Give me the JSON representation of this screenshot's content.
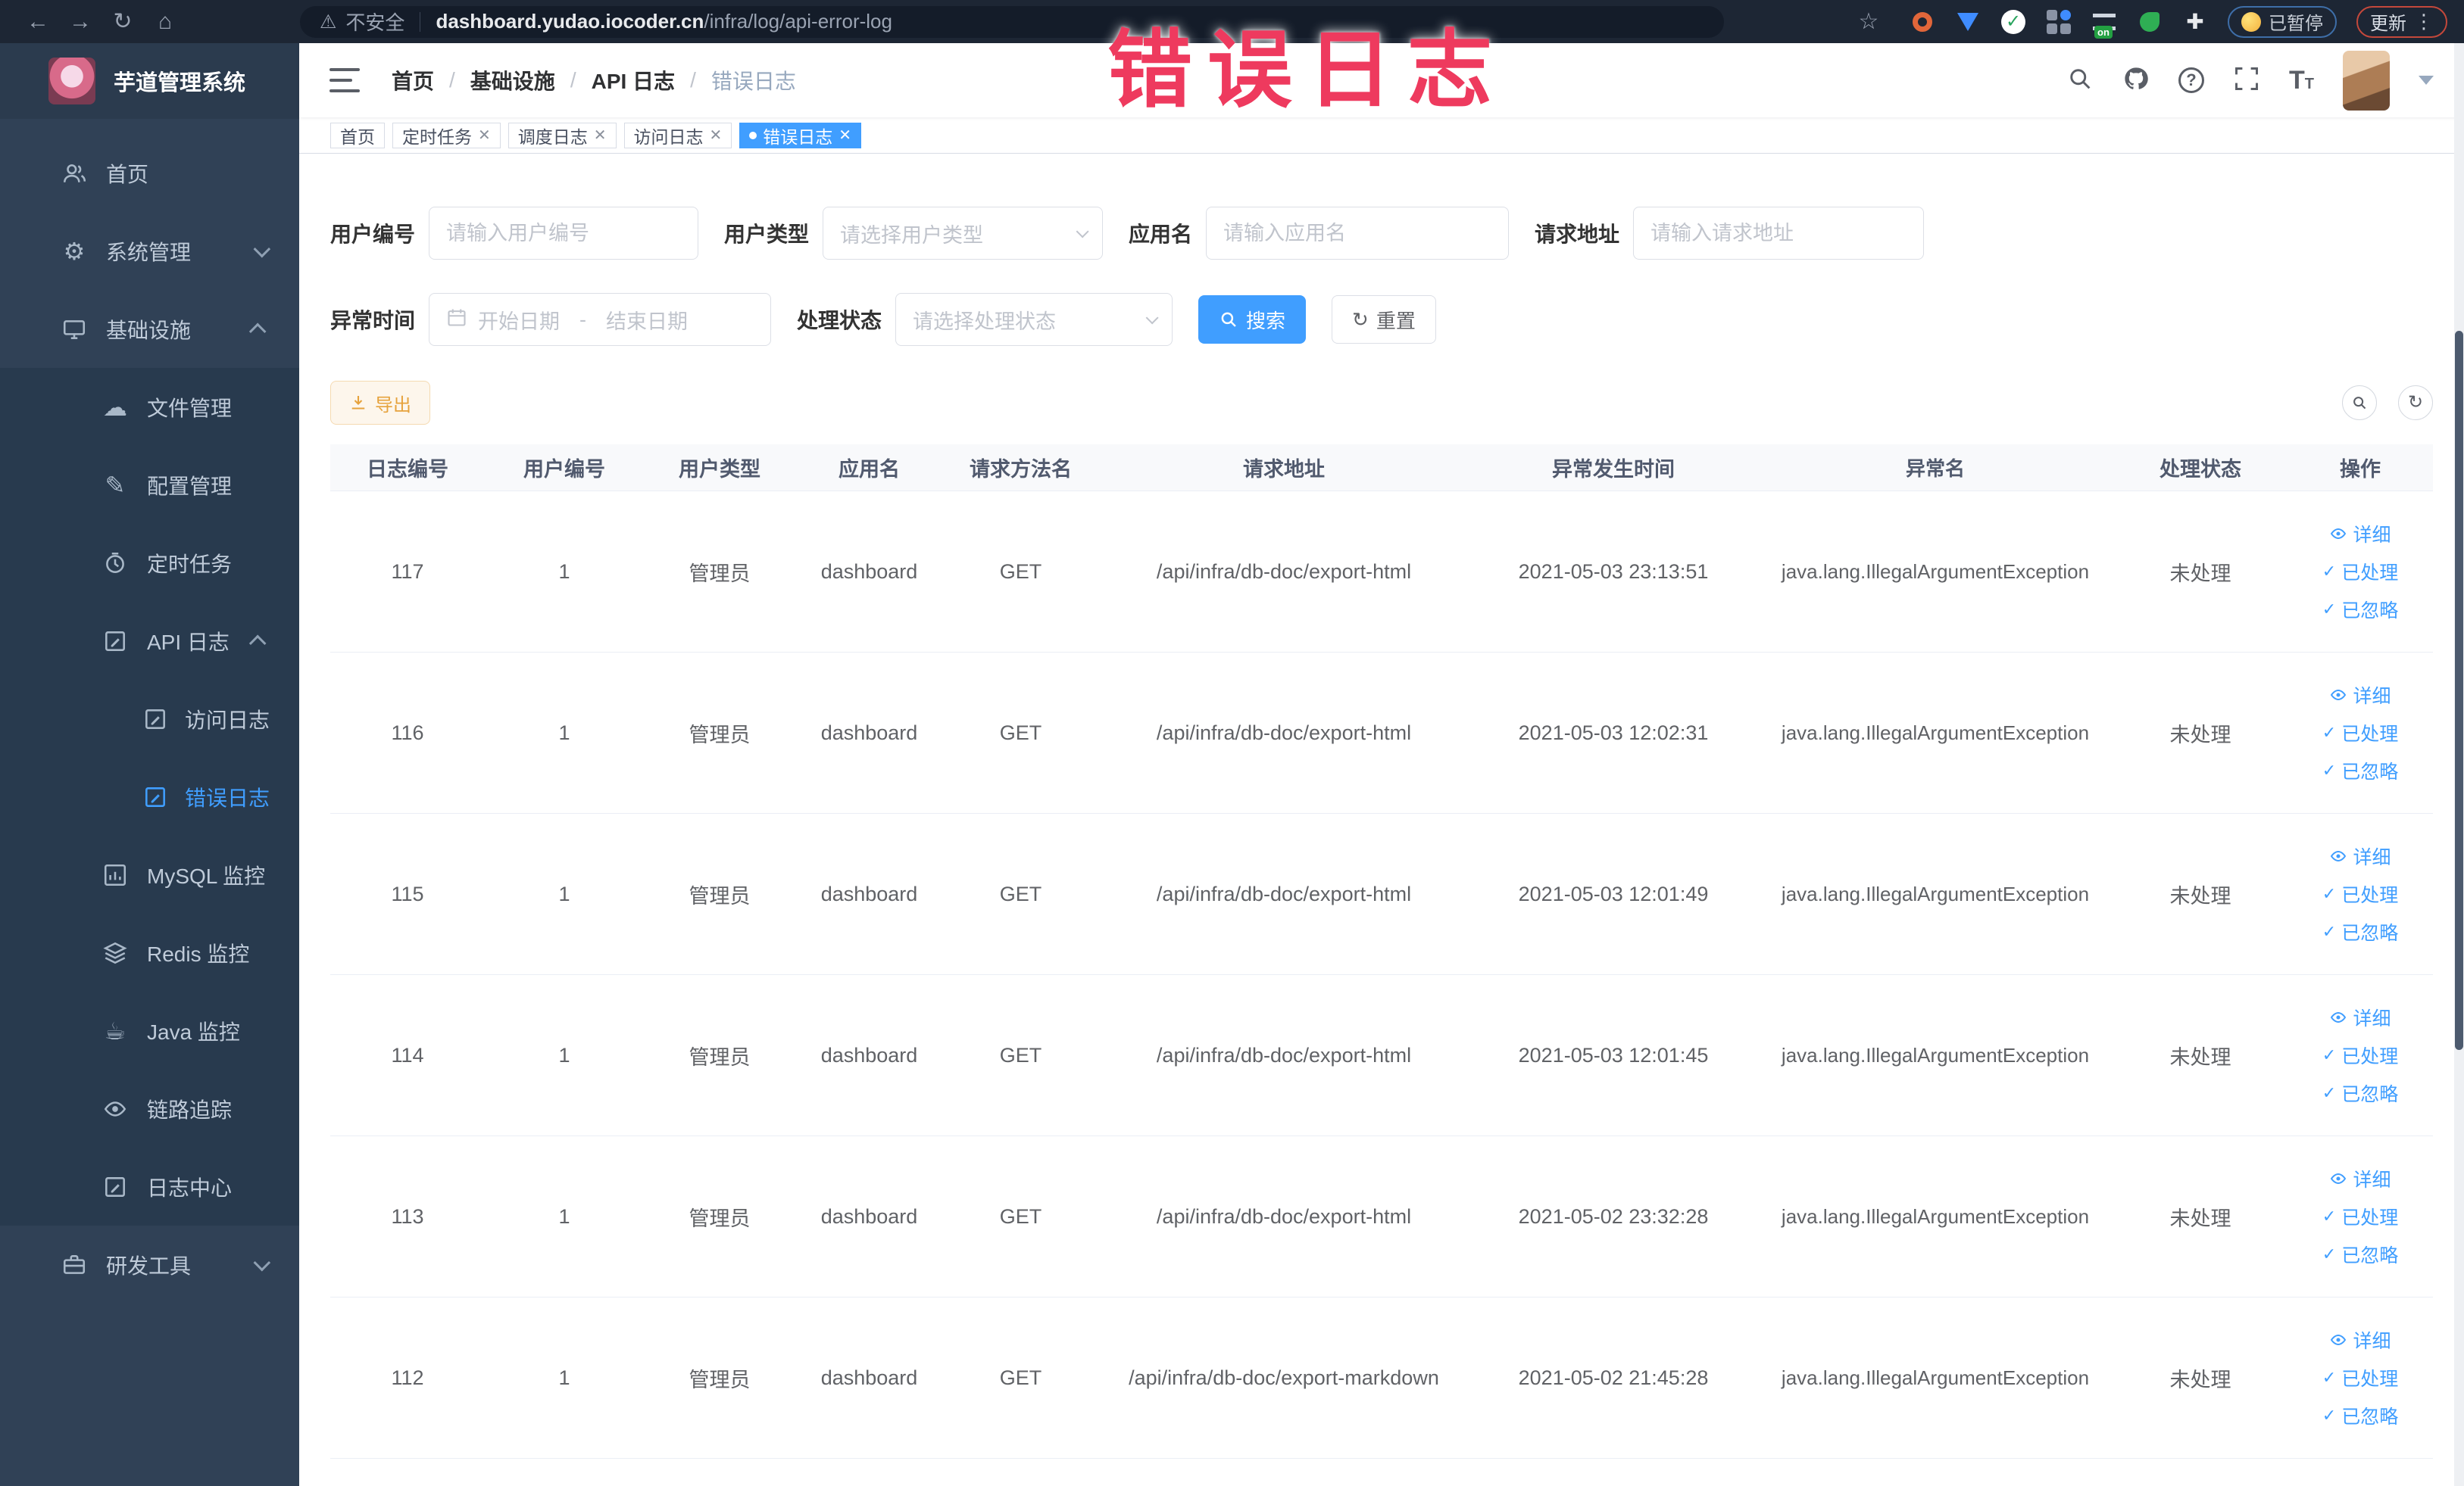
{
  "browser": {
    "security_label": "不安全",
    "url_domain": "dashboard.yudao.iocoder.cn",
    "url_path": "/infra/log/api-error-log",
    "paused_label": "已暂停",
    "update_label": "更新"
  },
  "annotation": {
    "text": "错误日志",
    "color": "#EE3A5E"
  },
  "sidebar": {
    "title": "芋道管理系统",
    "items": [
      {
        "label": "首页"
      },
      {
        "label": "系统管理"
      },
      {
        "label": "基础设施"
      },
      {
        "label": "文件管理"
      },
      {
        "label": "配置管理"
      },
      {
        "label": "定时任务"
      },
      {
        "label": "API 日志"
      },
      {
        "label": "访问日志"
      },
      {
        "label": "错误日志"
      },
      {
        "label": "MySQL 监控"
      },
      {
        "label": "Redis 监控"
      },
      {
        "label": "Java 监控"
      },
      {
        "label": "链路追踪"
      },
      {
        "label": "日志中心"
      },
      {
        "label": "研发工具"
      }
    ]
  },
  "navbar": {
    "breadcrumb": [
      "首页",
      "基础设施",
      "API 日志",
      "错误日志"
    ]
  },
  "tabs": [
    {
      "label": "首页"
    },
    {
      "label": "定时任务"
    },
    {
      "label": "调度日志"
    },
    {
      "label": "访问日志"
    },
    {
      "label": "错误日志"
    }
  ],
  "filters": {
    "user_id": {
      "label": "用户编号",
      "placeholder": "请输入用户编号"
    },
    "user_type": {
      "label": "用户类型",
      "placeholder": "请选择用户类型"
    },
    "app_name": {
      "label": "应用名",
      "placeholder": "请输入应用名"
    },
    "request_url": {
      "label": "请求地址",
      "placeholder": "请输入请求地址"
    },
    "exception_time": {
      "label": "异常时间",
      "start_placeholder": "开始日期",
      "separator": "-",
      "end_placeholder": "结束日期"
    },
    "process_status": {
      "label": "处理状态",
      "placeholder": "请选择处理状态"
    },
    "search_label": "搜索",
    "reset_label": "重置"
  },
  "toolbar": {
    "export_label": "导出"
  },
  "actions": {
    "detail": "详细",
    "processed": "已处理",
    "ignored": "已忽略"
  },
  "table": {
    "columns": [
      "日志编号",
      "用户编号",
      "用户类型",
      "应用名",
      "请求方法名",
      "请求地址",
      "异常发生时间",
      "异常名",
      "处理状态",
      "操作"
    ],
    "rows": [
      {
        "log_id": "117",
        "user_id": "1",
        "user_type": "管理员",
        "app_name": "dashboard",
        "method": "GET",
        "url": "/api/infra/db-doc/export-html",
        "time": "2021-05-03 23:13:51",
        "exception": "java.lang.IllegalArgumentException",
        "status": "未处理"
      },
      {
        "log_id": "116",
        "user_id": "1",
        "user_type": "管理员",
        "app_name": "dashboard",
        "method": "GET",
        "url": "/api/infra/db-doc/export-html",
        "time": "2021-05-03 12:02:31",
        "exception": "java.lang.IllegalArgumentException",
        "status": "未处理"
      },
      {
        "log_id": "115",
        "user_id": "1",
        "user_type": "管理员",
        "app_name": "dashboard",
        "method": "GET",
        "url": "/api/infra/db-doc/export-html",
        "time": "2021-05-03 12:01:49",
        "exception": "java.lang.IllegalArgumentException",
        "status": "未处理"
      },
      {
        "log_id": "114",
        "user_id": "1",
        "user_type": "管理员",
        "app_name": "dashboard",
        "method": "GET",
        "url": "/api/infra/db-doc/export-html",
        "time": "2021-05-03 12:01:45",
        "exception": "java.lang.IllegalArgumentException",
        "status": "未处理"
      },
      {
        "log_id": "113",
        "user_id": "1",
        "user_type": "管理员",
        "app_name": "dashboard",
        "method": "GET",
        "url": "/api/infra/db-doc/export-html",
        "time": "2021-05-02 23:32:28",
        "exception": "java.lang.IllegalArgumentException",
        "status": "未处理"
      },
      {
        "log_id": "112",
        "user_id": "1",
        "user_type": "管理员",
        "app_name": "dashboard",
        "method": "GET",
        "url": "/api/infra/db-doc/export-markdown",
        "time": "2021-05-02 21:45:28",
        "exception": "java.lang.IllegalArgumentException",
        "status": "未处理"
      }
    ]
  },
  "colors": {
    "accent": "#409EFF",
    "sidebar_bg": "#304156",
    "warning": "#E6A23C",
    "annotation": "#EE3A5E",
    "tab_active": "#409EFF"
  }
}
